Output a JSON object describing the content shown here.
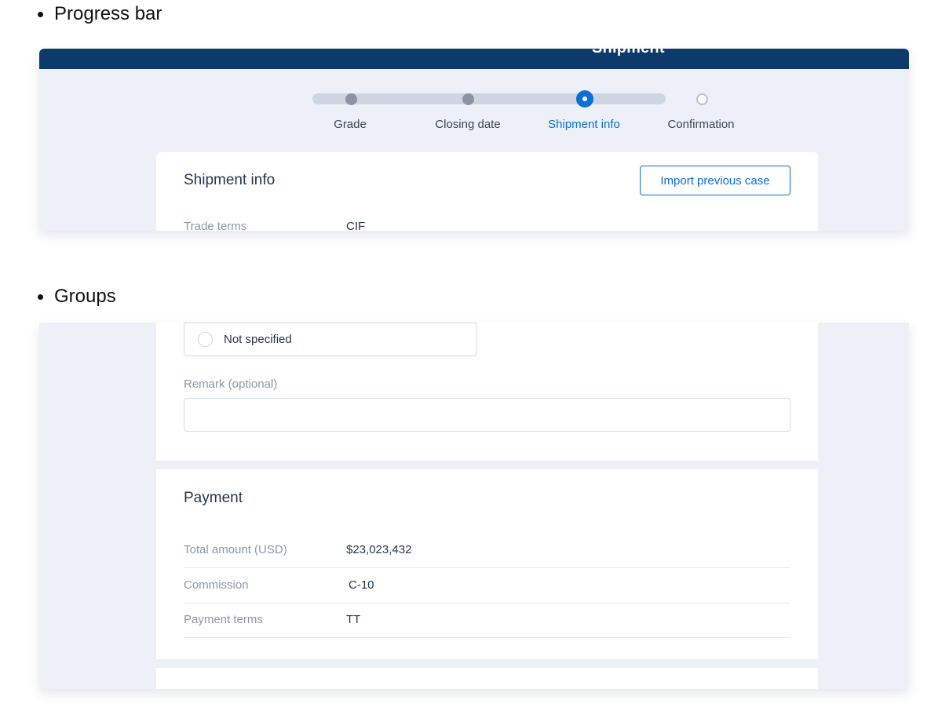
{
  "sections": {
    "progress_bar_heading": "Progress bar",
    "groups_heading": "Groups"
  },
  "header": {
    "title": "Shipment"
  },
  "stepper": {
    "steps": [
      {
        "label": "Grade",
        "state": "done"
      },
      {
        "label": "Closing date",
        "state": "done"
      },
      {
        "label": "Shipment info",
        "state": "current"
      },
      {
        "label": "Confirmation",
        "state": "todo"
      }
    ]
  },
  "shipment_card": {
    "title": "Shipment info",
    "import_button": "Import previous case",
    "trade_terms_label": "Trade terms",
    "trade_terms_value": "CIF"
  },
  "groups_card": {
    "radio_option": "Not specified",
    "remark_label": "Remark (optional)",
    "remark_value": ""
  },
  "payment": {
    "title": "Payment",
    "rows": [
      {
        "label": "Total amount (USD)",
        "value": "$23,023,432"
      },
      {
        "label": "Commission",
        "value": "C-10"
      },
      {
        "label": "Payment terms",
        "value": "TT"
      }
    ]
  },
  "colors": {
    "header_bg": "#0c3a6b",
    "accent": "#0a6fd8",
    "panel_bg": "#edf1f7"
  }
}
